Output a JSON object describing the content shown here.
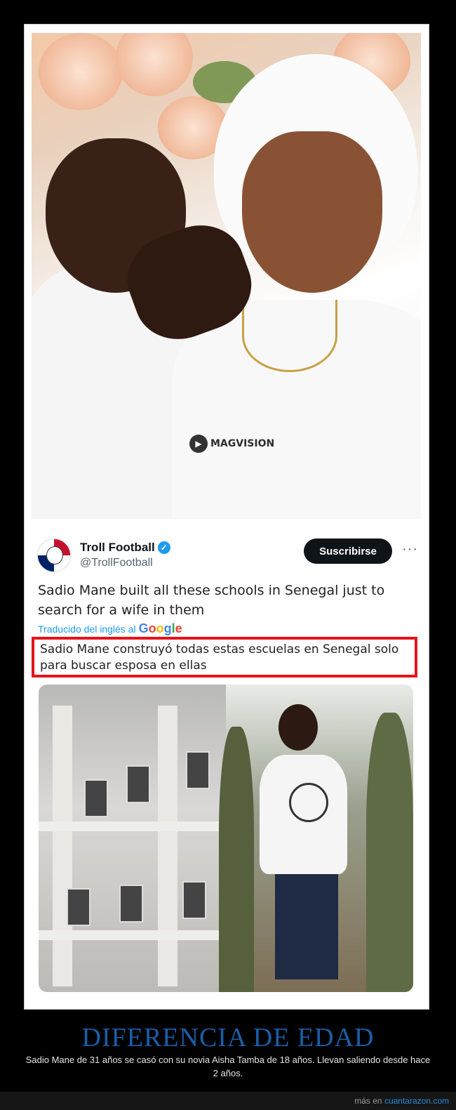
{
  "meme": {
    "title": "DIFERENCIA DE EDAD",
    "description": "Sadio Mane de 31 años se casó con su novia Aisha Tamba de 18 años. Llevan saliendo desde hace 2 años."
  },
  "photo": {
    "watermark": "MAGVISION"
  },
  "tweet": {
    "author_name": "Troll Football",
    "author_handle": "@TrollFootball",
    "subscribe_label": "Suscribirse",
    "more_label": "···",
    "text": "Sadio Mane built all these schools in Senegal just to search for a wife in them",
    "translated_label": "Traducido del inglés al",
    "translation_provider": "Google",
    "translation": "Sadio Mane construyó todas estas escuelas en Senegal solo para buscar esposa en ellas",
    "verified_icon": "verified-badge-icon"
  },
  "footer": {
    "prefix": "más en",
    "link": "cuantarazon.com"
  },
  "colors": {
    "title": "#1a5ea8",
    "highlight_border": "#e5141b",
    "link": "#1d9bf0"
  }
}
